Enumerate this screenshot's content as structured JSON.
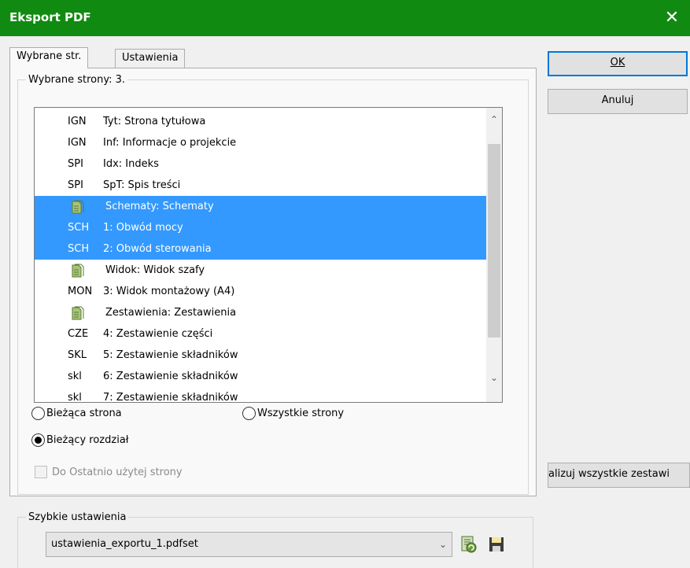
{
  "window": {
    "title": "Eksport PDF",
    "close_glyph": "✕"
  },
  "tabs": [
    {
      "label": "Wybrane str.",
      "active": true
    },
    {
      "label": "Ustawienia",
      "active": false
    }
  ],
  "selected_group": {
    "legend": "Wybrane strony: 3.",
    "pages": [
      {
        "code": "IGN",
        "label": "Tyt: Strona tytułowa",
        "type": "page",
        "selected": false
      },
      {
        "code": "IGN",
        "label": "Inf: Informacje o projekcie",
        "type": "page",
        "selected": false
      },
      {
        "code": "SPI",
        "label": "Idx: Indeks",
        "type": "page",
        "selected": false
      },
      {
        "code": "SPI",
        "label": "SpT: Spis treści",
        "type": "page",
        "selected": false
      },
      {
        "code": "",
        "label": "Schematy: Schematy",
        "type": "folder",
        "selected": true
      },
      {
        "code": "SCH",
        "label": "1: Obwód mocy",
        "type": "page",
        "selected": true
      },
      {
        "code": "SCH",
        "label": "2: Obwód sterowania",
        "type": "page",
        "selected": true
      },
      {
        "code": "",
        "label": "Widok: Widok szafy",
        "type": "folder",
        "selected": false
      },
      {
        "code": "MON",
        "label": "3: Widok montażowy (A4)",
        "type": "page",
        "selected": false
      },
      {
        "code": "",
        "label": "Zestawienia: Zestawienia",
        "type": "folder",
        "selected": false
      },
      {
        "code": "CZE",
        "label": "4: Zestawienie części",
        "type": "page",
        "selected": false
      },
      {
        "code": "SKL",
        "label": "5: Zestawienie składników",
        "type": "page",
        "selected": false
      },
      {
        "code": "skl",
        "label": "6: Zestawienie składników",
        "type": "page",
        "selected": false
      },
      {
        "code": "skl",
        "label": "7: Zestawienie składników",
        "type": "page",
        "selected": false
      }
    ],
    "scroll": {
      "up_glyph": "⌃",
      "down_glyph": "⌄"
    }
  },
  "options": {
    "current_page": {
      "label": "Bieżąca strona",
      "checked": false
    },
    "all_pages": {
      "label": "Wszystkie strony",
      "checked": false
    },
    "current_chapter": {
      "label": "Bieżący rozdział",
      "checked": true
    },
    "to_last_used": {
      "label": "Do Ostatnio użytej strony",
      "checked": false,
      "disabled": true
    }
  },
  "quick_settings": {
    "legend": "Szybkie ustawienia",
    "selected": "ustawienia_exportu_1.pdfset",
    "chevron_glyph": "⌄"
  },
  "buttons": {
    "ok": "OK",
    "cancel": "Anuluj",
    "update_all": "alizuj wszystkie zestawi"
  },
  "icons": {
    "folder": "document-folder-icon",
    "refresh": "refresh-settings-icon",
    "save": "floppy-disk-icon"
  },
  "colors": {
    "titlebar": "#108a10",
    "selection": "#3399ff",
    "default_button_border": "#0078d7"
  }
}
